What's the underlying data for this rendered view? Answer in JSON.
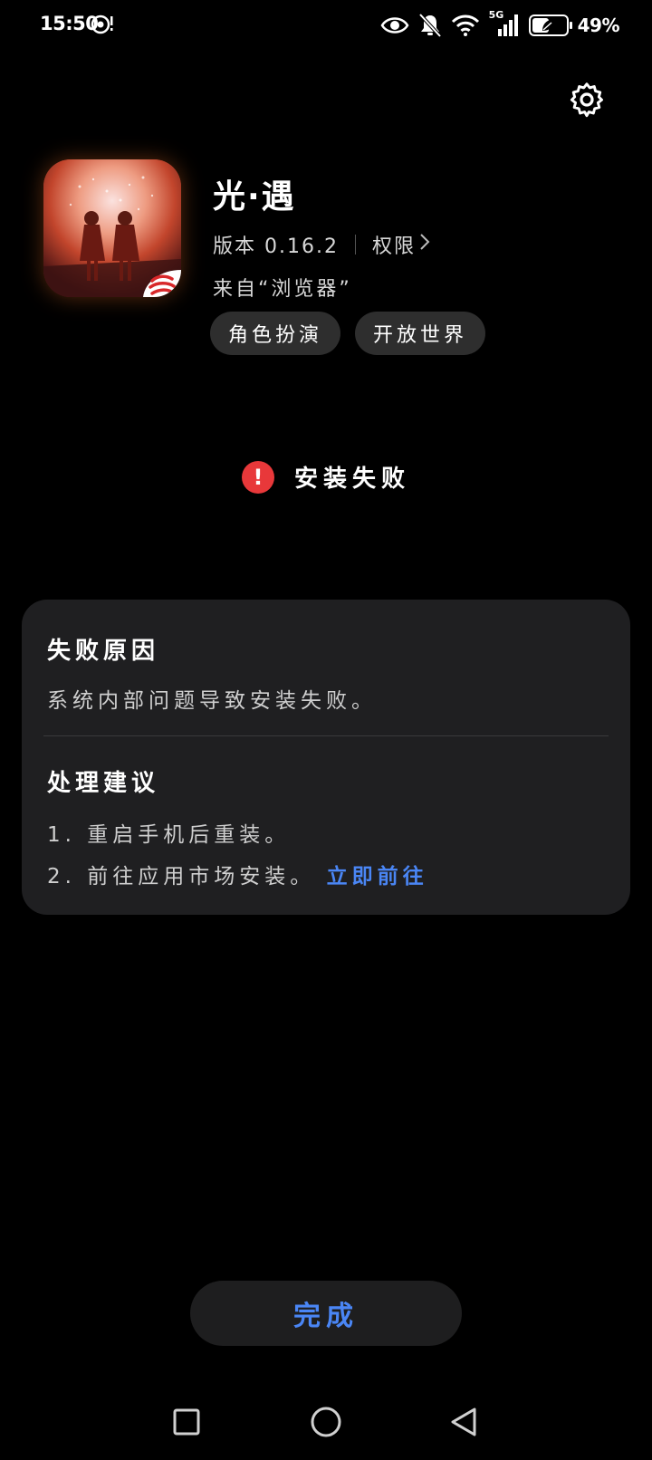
{
  "status_bar": {
    "time": "15:50",
    "network": "5G",
    "battery_percent": "49%",
    "battery_level": 0.49,
    "icons": [
      "eye-icon",
      "bell-muted-icon",
      "wifi-icon",
      "cellular-signal-icon",
      "battery-saver-icon"
    ]
  },
  "app": {
    "name": "光·遇",
    "version_label": "版本 0.16.2",
    "permissions_label": "权限",
    "source_label": "来自“浏览器”",
    "tags": [
      "角色扮演",
      "开放世界"
    ]
  },
  "result": {
    "status_text": "安装失败",
    "icon": "error-icon",
    "color": "#e8383a"
  },
  "details": {
    "reason_title": "失败原因",
    "reason_text": "系统内部问题导致安装失败。",
    "advice_title": "处理建议",
    "advice_items": [
      {
        "text": "1. 重启手机后重装。"
      },
      {
        "text": "2. 前往应用市场安装。",
        "link": "立即前往"
      }
    ]
  },
  "footer": {
    "done_label": "完成"
  },
  "nav": {
    "buttons": [
      "recent-apps",
      "home",
      "back"
    ]
  },
  "colors": {
    "accent": "#4a86f5",
    "background": "#000000",
    "card": "#1f1f21",
    "error": "#e8383a"
  }
}
